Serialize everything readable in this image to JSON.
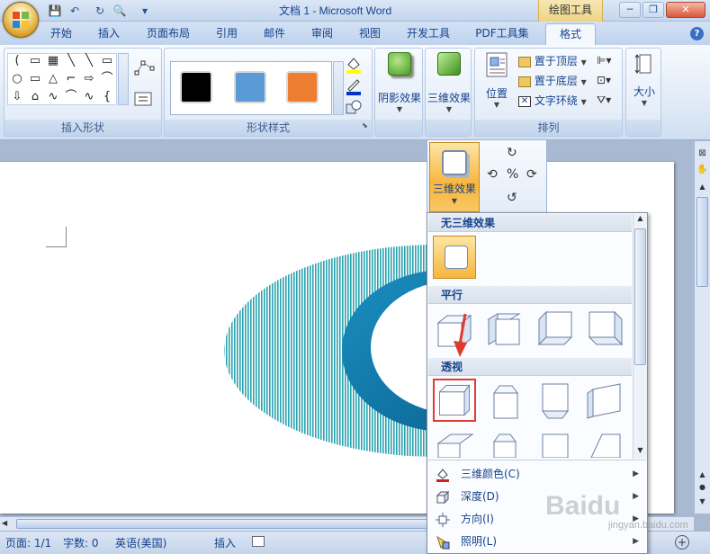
{
  "window": {
    "title": "文档 1 - Microsoft Word",
    "contextual_tab": "绘图工具",
    "controls": [
      "─",
      "❐",
      "✕"
    ]
  },
  "qat": {
    "icons": [
      "save-icon",
      "undo-icon",
      "redo-icon",
      "print-preview-icon",
      "customize-icon"
    ],
    "glyphs": [
      "💾",
      "↶",
      "↻",
      "🔍",
      "▾"
    ]
  },
  "tabs": [
    {
      "label": "开始"
    },
    {
      "label": "插入"
    },
    {
      "label": "页面布局"
    },
    {
      "label": "引用"
    },
    {
      "label": "邮件"
    },
    {
      "label": "审阅"
    },
    {
      "label": "视图"
    },
    {
      "label": "开发工具"
    },
    {
      "label": "PDF工具集"
    },
    {
      "label": "格式",
      "active": true
    }
  ],
  "help": "?",
  "ribbon": {
    "insert_shapes": {
      "label": "插入形状",
      "shapes": [
        "(",
        "▭",
        "▦",
        "╲",
        "╲",
        "▭",
        "○",
        "▭",
        "△",
        "⌐",
        "⇨",
        "⌒",
        "⇩",
        "⌂",
        "∿",
        "⌒",
        "∿",
        "{"
      ]
    },
    "shape_styles": {
      "label": "形状样式",
      "swatches": [
        "#000000",
        "#5b9bd5",
        "#ed7d31"
      ]
    },
    "shadow": {
      "label": "阴影效果"
    },
    "three_d": {
      "label": "三维效果"
    },
    "arrange": {
      "label": "排列",
      "position": "位置",
      "bring_front": "置于顶层",
      "send_back": "置于底层",
      "text_wrap": "文字环绕"
    },
    "size": {
      "label": "大小"
    }
  },
  "panel_3d": {
    "label": "三维效果"
  },
  "dropdown": {
    "sections": [
      {
        "title": "无三维效果"
      },
      {
        "title": "平行"
      },
      {
        "title": "透视"
      }
    ],
    "menu": [
      {
        "label": "三维颜色(C)",
        "icon": "3d-color-icon"
      },
      {
        "label": "深度(D)",
        "icon": "depth-icon"
      },
      {
        "label": "方向(I)",
        "icon": "direction-icon"
      },
      {
        "label": "照明(L)",
        "icon": "lighting-icon"
      }
    ]
  },
  "status": {
    "page": "页面: 1/1",
    "words": "字数: 0",
    "language": "英语(美国)",
    "mode": "插入"
  },
  "watermark": {
    "text": "Baidu",
    "url": "jingyan.baidu.com"
  }
}
